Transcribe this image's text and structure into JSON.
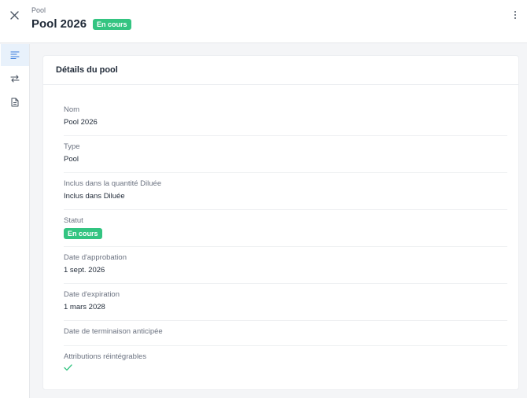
{
  "header": {
    "breadcrumb": "Pool",
    "title": "Pool 2026",
    "status_badge": "En cours"
  },
  "sidebar": {
    "items": [
      {
        "icon": "details-lines-icon",
        "active": true
      },
      {
        "icon": "transfer-arrows-icon",
        "active": false
      },
      {
        "icon": "document-icon",
        "active": false
      }
    ]
  },
  "card": {
    "title": "Détails du pool",
    "fields": {
      "nom": {
        "label": "Nom",
        "value": "Pool 2026"
      },
      "type": {
        "label": "Type",
        "value": "Pool"
      },
      "inclus": {
        "label": "Inclus dans la quantité Diluée",
        "value": "Inclus dans Diluée"
      },
      "statut": {
        "label": "Statut",
        "value": "En cours"
      },
      "approbation": {
        "label": "Date d'approbation",
        "value": "1 sept. 2026"
      },
      "expiration": {
        "label": "Date d'expiration",
        "value": "1 mars 2028"
      },
      "terminaison": {
        "label": "Date de terminaison anticipée"
      },
      "attributions": {
        "label": "Attributions réintégrables",
        "icon": "check-icon"
      }
    }
  },
  "colors": {
    "accent_green": "#33c481",
    "active_blue_bg": "#e8f1fb",
    "icon_blue": "#3b7ddd"
  }
}
